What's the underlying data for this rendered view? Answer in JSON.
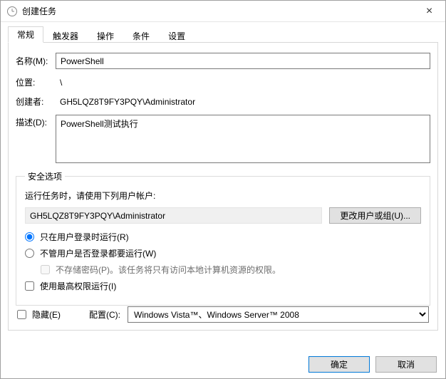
{
  "window": {
    "title": "创建任务",
    "close_symbol": "×"
  },
  "tabs": {
    "general": "常规",
    "triggers": "触发器",
    "actions": "操作",
    "conditions": "条件",
    "settings": "设置"
  },
  "general": {
    "name_label": "名称(M):",
    "name_value": "PowerShell",
    "location_label": "位置:",
    "location_value": "\\",
    "author_label": "创建者:",
    "author_value": "GH5LQZ8T9FY3PQY\\Administrator",
    "desc_label": "描述(D):",
    "desc_value": "PowerShell测试执行"
  },
  "security": {
    "legend": "安全选项",
    "run_as_prompt": "运行任务时，请使用下列用户帐户:",
    "account": "GH5LQZ8T9FY3PQY\\Administrator",
    "change_user_btn": "更改用户或组(U)...",
    "radio_logged_on": "只在用户登录时运行(R)",
    "radio_any": "不管用户是否登录都要运行(W)",
    "no_store_pw": "不存储密码(P)。该任务将只有访问本地计算机资源的权限。",
    "highest_priv": "使用最高权限运行(I)"
  },
  "footer": {
    "hidden_label": "隐藏(E)",
    "config_label": "配置(C):",
    "config_value": "Windows Vista™、Windows Server™ 2008"
  },
  "buttons": {
    "ok": "确定",
    "cancel": "取消"
  }
}
